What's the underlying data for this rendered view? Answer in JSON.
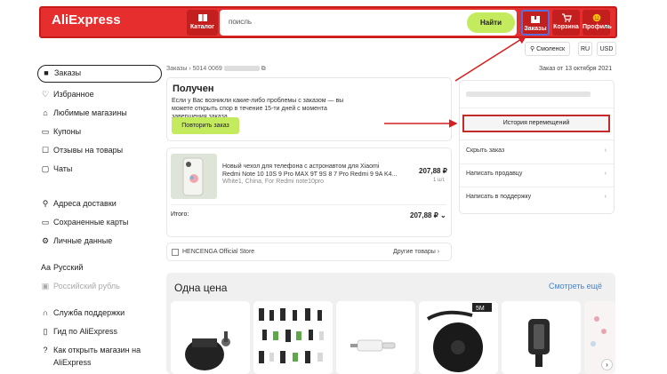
{
  "header": {
    "logo": "AliExpress",
    "catalog_label": "Каталог",
    "search_value": "поисль",
    "search_button": "Найти",
    "orders_label": "Заказы",
    "cart_label": "Корзина",
    "profile_label": "Профиль"
  },
  "subheader": {
    "location": "Смоленск",
    "language": "RU",
    "currency": "USD"
  },
  "sidebar": {
    "items": [
      {
        "label": "Заказы",
        "icon": "box-icon"
      },
      {
        "label": "Избранное",
        "icon": "heart-icon"
      },
      {
        "label": "Любимые магазины",
        "icon": "store-icon"
      },
      {
        "label": "Купоны",
        "icon": "coupon-icon"
      },
      {
        "label": "Отзывы на товары",
        "icon": "review-icon"
      },
      {
        "label": "Чаты",
        "icon": "chat-icon"
      },
      {
        "label": "Адреса доставки",
        "icon": "pin-icon"
      },
      {
        "label": "Сохраненные карты",
        "icon": "card-icon"
      },
      {
        "label": "Личные данные",
        "icon": "gear-icon"
      },
      {
        "label": "Русский",
        "icon": "language-icon"
      },
      {
        "label": "Российский рубль",
        "icon": "currency-icon"
      },
      {
        "label": "Служба поддержки",
        "icon": "headset-icon"
      },
      {
        "label": "Гид по AliExpress",
        "icon": "book-icon"
      },
      {
        "label": "Как открыть магазин на",
        "icon": "help-icon"
      },
      {
        "label": "AliExpress",
        "icon": ""
      }
    ]
  },
  "order": {
    "breadcrumb_root": "Заказы",
    "order_prefix": "5014 0069",
    "date": "Заказ от 13 октября 2021",
    "status_title": "Получен",
    "status_text": "Если у Вас возникли какие-либо проблемы с заказом — вы можете открыть спор в течение 15-ти дней с момента завершения заказа",
    "repeat_button": "Повторить заказ",
    "item_title": "Новый чехол для телефона с астронавтом для Xiaomi Redmi Note 10 10S 9 Pro MAX 9T 9S 8 7 Pro Redmi 9 9A K4...",
    "item_variant": "White1, China, For Redmi note10pro",
    "item_price": "207,88 ₽",
    "item_qty": "1 шт.",
    "total_label": "Итого:",
    "total_value": "207,88 ₽",
    "store_name": "HENCENGA Official Store",
    "other_goods": "Другие товары"
  },
  "right_panel": {
    "history_button": "История перемещений",
    "hide_order": "Скрыть заказ",
    "write_seller": "Написать продавцу",
    "write_support": "Написать в поддержку"
  },
  "products": {
    "title": "Одна цена",
    "see_more": "Смотреть ещё"
  },
  "colors": {
    "brand_red": "#e62e2e",
    "accent_green": "#c4ea5d",
    "link_blue": "#4a84c9"
  }
}
